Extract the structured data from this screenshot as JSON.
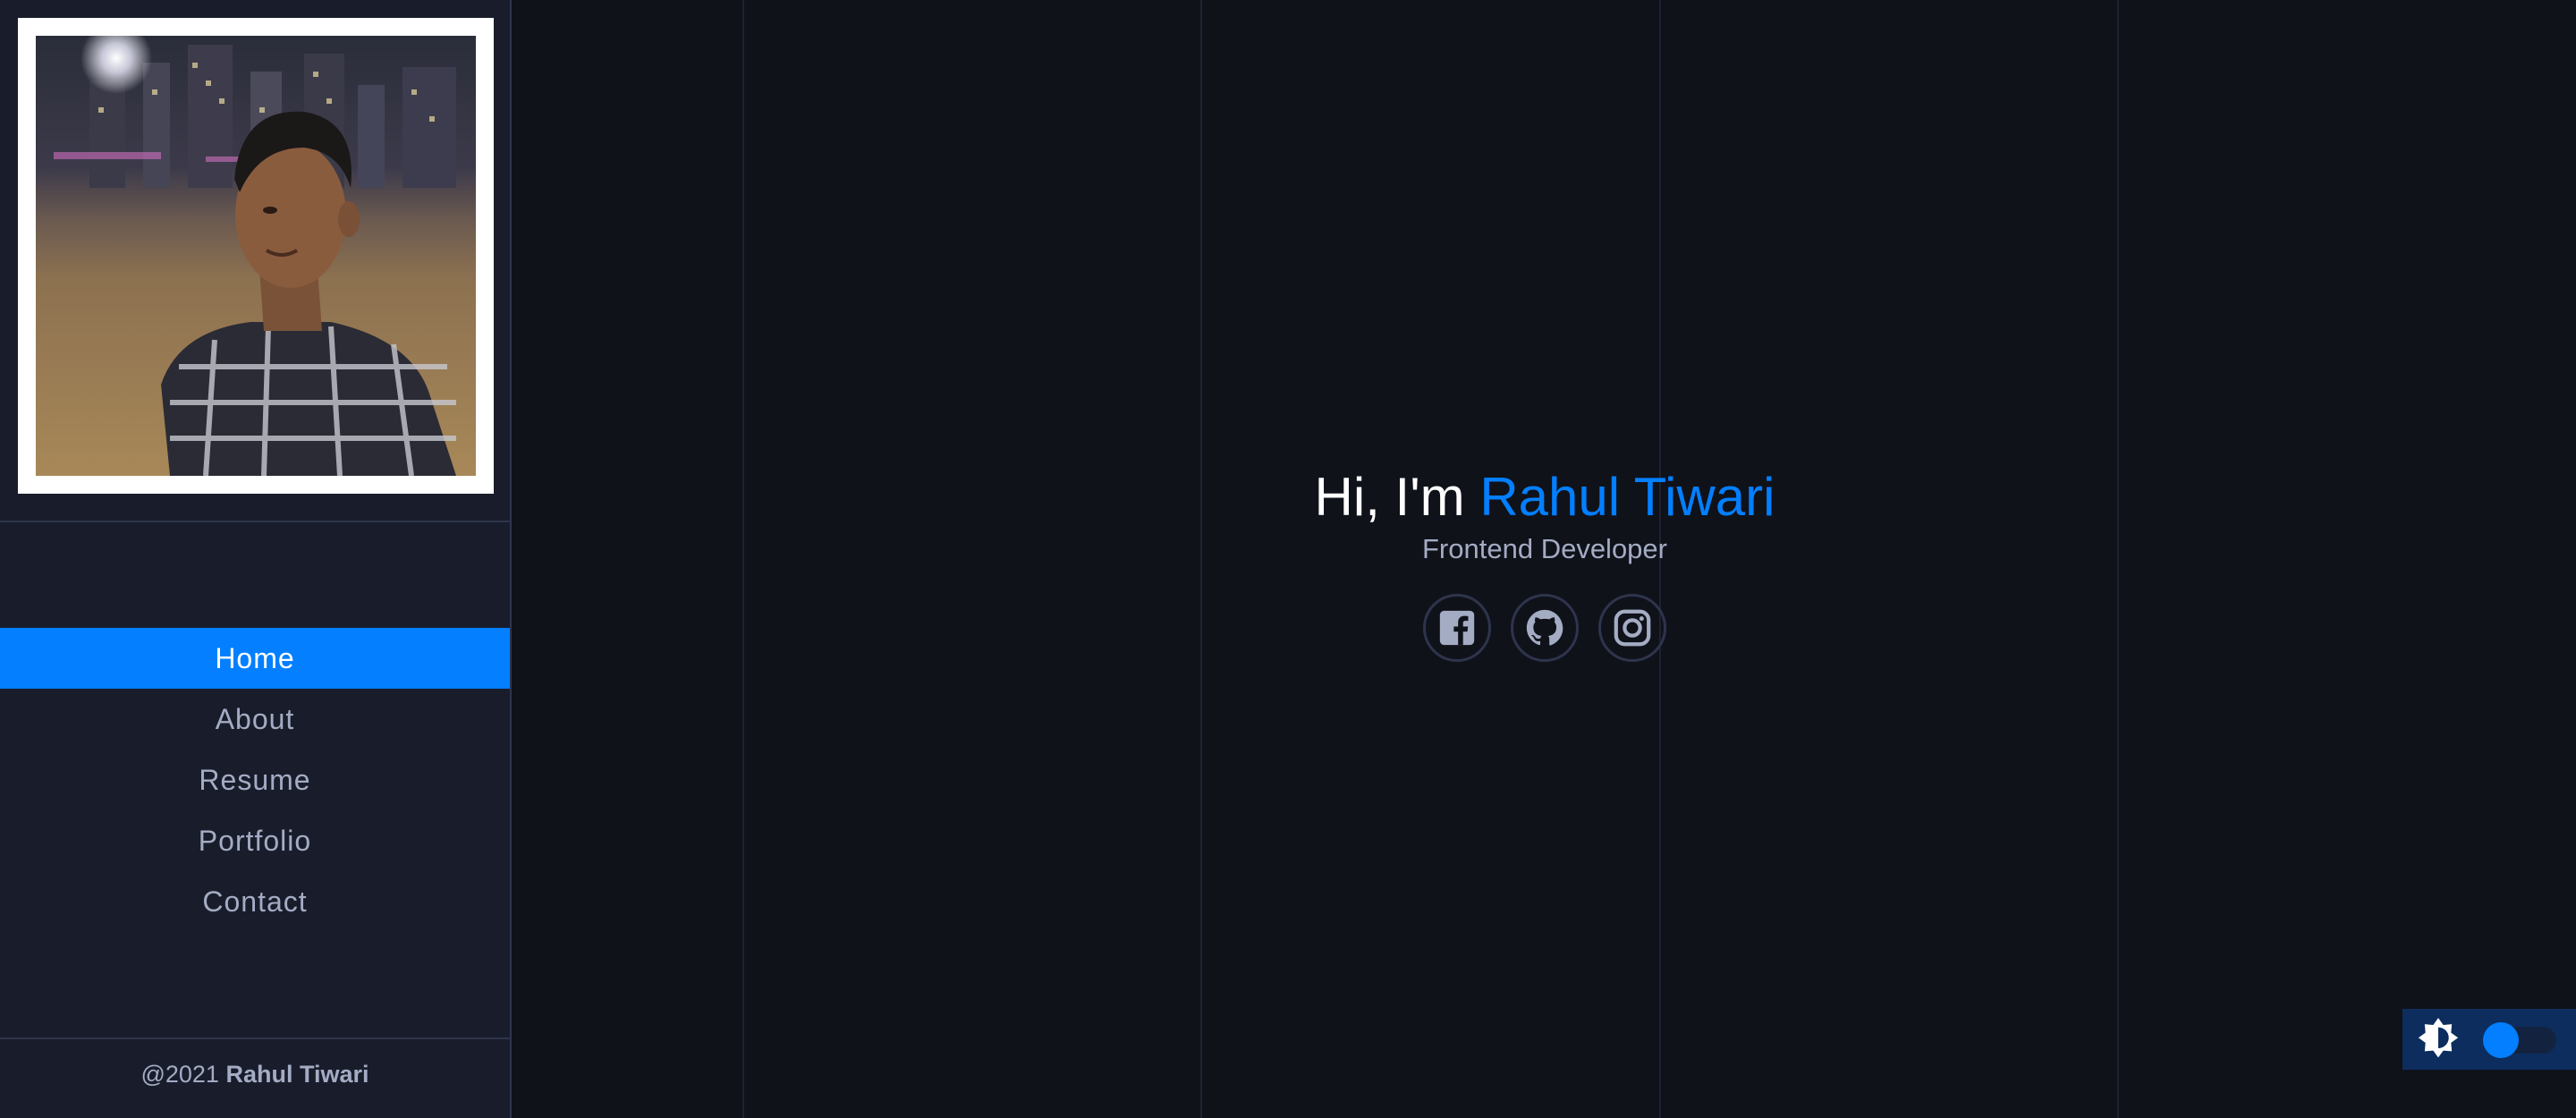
{
  "sidebar": {
    "avatar_alt": "Profile photo",
    "nav": [
      {
        "label": "Home",
        "active": true
      },
      {
        "label": "About",
        "active": false
      },
      {
        "label": "Resume",
        "active": false
      },
      {
        "label": "Portfolio",
        "active": false
      },
      {
        "label": "Contact",
        "active": false
      }
    ],
    "footer": {
      "prefix": "@2021",
      "name": "Rahul Tiwari"
    }
  },
  "hero": {
    "greeting": "Hi, I'm",
    "name": "Rahul Tiwari",
    "subtitle": "Frontend Developer",
    "socials": [
      {
        "icon": "facebook-icon"
      },
      {
        "icon": "github-icon"
      },
      {
        "icon": "instagram-icon"
      }
    ]
  },
  "theme_toggle": {
    "icon": "brightness-icon",
    "state": "dark"
  },
  "colors": {
    "accent": "#037fff",
    "sidebar_bg": "#191d2b",
    "main_bg": "#10121a",
    "text_muted": "#a4acc4",
    "border": "#2e344d"
  }
}
